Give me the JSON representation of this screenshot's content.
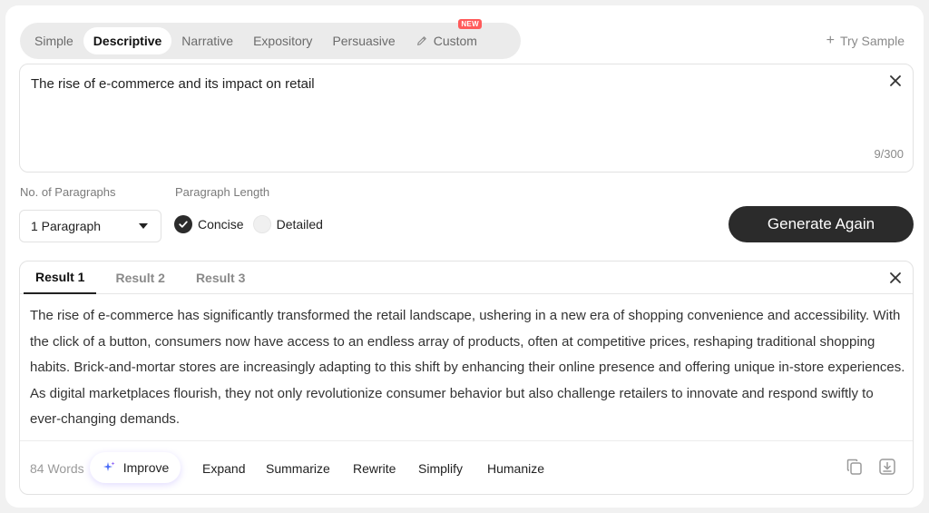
{
  "style_tabs": [
    {
      "label": "Simple",
      "active": false
    },
    {
      "label": "Descriptive",
      "active": true
    },
    {
      "label": "Narrative",
      "active": false
    },
    {
      "label": "Expository",
      "active": false
    },
    {
      "label": "Persuasive",
      "active": false
    },
    {
      "label": "Custom",
      "active": false,
      "badge": "NEW",
      "icon": "pen-icon"
    }
  ],
  "try_sample": {
    "icon": "plus-icon",
    "label": "Try Sample"
  },
  "topic": {
    "value": "The rise of e-commerce and its impact on retail",
    "char_count": "9/300"
  },
  "options": {
    "paragraphs_label": "No. of Paragraphs",
    "paragraphs_value": "1 Paragraph",
    "length_label": "Paragraph Length",
    "length_options": [
      {
        "label": "Concise",
        "checked": true
      },
      {
        "label": "Detailed",
        "checked": false
      }
    ]
  },
  "generate_button": "Generate Again",
  "results": {
    "tabs": [
      {
        "label": "Result 1",
        "active": true
      },
      {
        "label": "Result 2",
        "active": false
      },
      {
        "label": "Result 3",
        "active": false
      }
    ],
    "text": "The rise of e-commerce has significantly transformed the retail landscape, ushering in a new era of shopping convenience and accessibility. With the click of a button, consumers now have access to an endless array of products, often at competitive prices, reshaping traditional shopping habits. Brick-and-mortar stores are increasingly adapting to this shift by enhancing their online presence and offering unique in-store experiences. As digital marketplaces flourish, they not only revolutionize consumer behavior but also challenge retailers to innovate and respond swiftly to ever-changing demands.",
    "word_count": "84 Words",
    "improve_label": "Improve",
    "actions": [
      "Expand",
      "Summarize",
      "Rewrite",
      "Simplify",
      "Humanize"
    ]
  },
  "colors": {
    "accent_dark": "#2b2b2b",
    "badge_red": "#ff5a5a",
    "improve_glow": "#785aff"
  }
}
